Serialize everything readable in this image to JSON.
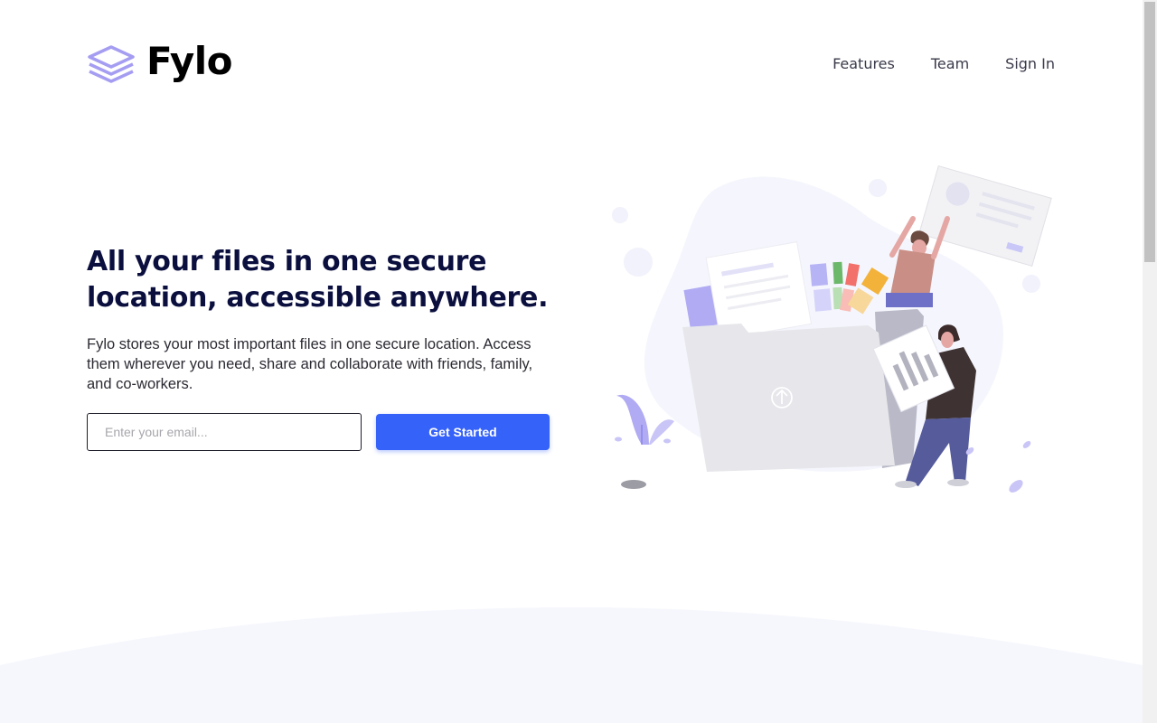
{
  "header": {
    "brand": "Fylo",
    "nav": [
      "Features",
      "Team",
      "Sign In"
    ]
  },
  "hero": {
    "title": "All your files in one secure location, accessible anywhere.",
    "description": "Fylo stores your most important files in one secure location. Access them wherever you need, share and collaborate with friends, family, and co-workers.",
    "email_placeholder": "Enter your email...",
    "email_value": "",
    "cta_label": "Get Started"
  },
  "colors": {
    "brand_accent": "#3562f8",
    "logo_purple": "#a59df2",
    "heading": "#0b0f3e",
    "wave_background": "#f6f7fd"
  },
  "icons": {
    "logo": "stacked-layers-icon",
    "upload": "upload-arrow-icon"
  }
}
